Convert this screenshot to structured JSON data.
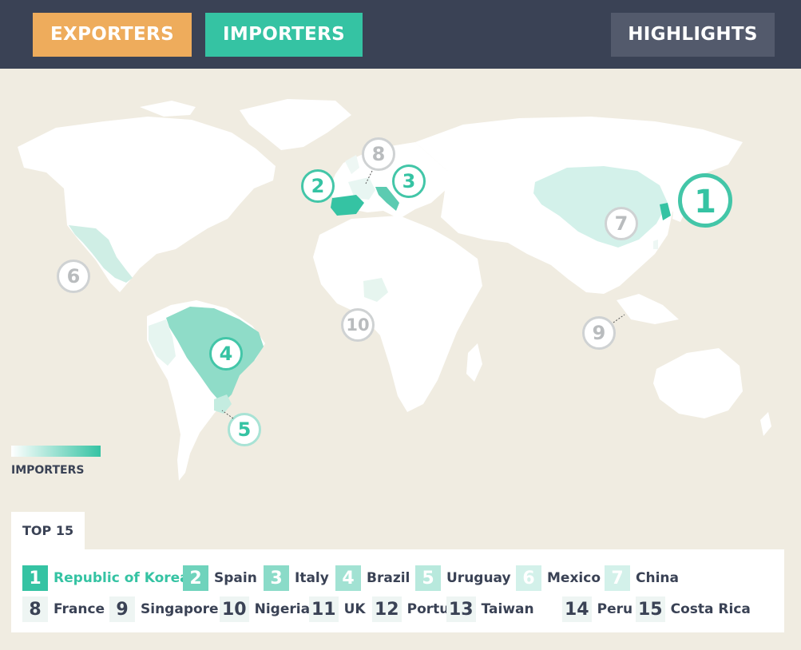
{
  "nav": {
    "tabs": [
      {
        "label": "EXPORTERS",
        "color": "#eeac5c"
      },
      {
        "label": "IMPORTERS",
        "color": "#35c3a3",
        "active": true
      },
      {
        "label": "HIGHLIGHTS",
        "color": "#535a6c"
      }
    ]
  },
  "map": {
    "background": "#f0ece1",
    "land_color": "#ffffff",
    "markers": [
      {
        "label": "1",
        "country": "Republic of Korea"
      },
      {
        "label": "2",
        "country": "Spain"
      },
      {
        "label": "3",
        "country": "Italy"
      },
      {
        "label": "4",
        "country": "Brazil"
      },
      {
        "label": "5",
        "country": "Uruguay"
      },
      {
        "label": "6",
        "country": "Mexico"
      },
      {
        "label": "7",
        "country": "China"
      },
      {
        "label": "8",
        "country": "France"
      },
      {
        "label": "9",
        "country": "Singapore"
      },
      {
        "label": "10",
        "country": "Nigeria"
      }
    ],
    "legend": {
      "label": "IMPORTERS",
      "from_color": "#ffffff",
      "to_color": "#35c3a3"
    }
  },
  "top15": {
    "title": "TOP 15",
    "items": [
      {
        "rank": "1",
        "name": "Republic of Korea",
        "bg": "#35c3a3",
        "fg": "#ffffff",
        "name_color": "#35c3a3"
      },
      {
        "rank": "2",
        "name": "Spain",
        "bg": "#6fd3bc",
        "fg": "#ffffff"
      },
      {
        "rank": "3",
        "name": "Italy",
        "bg": "#8adbc8",
        "fg": "#ffffff"
      },
      {
        "rank": "4",
        "name": "Brazil",
        "bg": "#a2e2d3",
        "fg": "#ffffff"
      },
      {
        "rank": "5",
        "name": "Uruguay",
        "bg": "#b8e9dd",
        "fg": "#ffffff"
      },
      {
        "rank": "6",
        "name": "Mexico",
        "bg": "#d3f1ea",
        "fg": "#ffffff"
      },
      {
        "rank": "7",
        "name": "China",
        "bg": "#d3f1ea",
        "fg": "#ffffff"
      },
      {
        "rank": "8",
        "name": "France",
        "bg": "#eef5f3",
        "fg": "#3a4255"
      },
      {
        "rank": "9",
        "name": "Singapore",
        "bg": "#eef5f3",
        "fg": "#3a4255"
      },
      {
        "rank": "10",
        "name": "Nigeria",
        "bg": "#eef5f3",
        "fg": "#3a4255"
      },
      {
        "rank": "11",
        "name": "UK",
        "bg": "#eef5f3",
        "fg": "#3a4255"
      },
      {
        "rank": "12",
        "name": "Portugal",
        "bg": "#eef5f3",
        "fg": "#3a4255"
      },
      {
        "rank": "13",
        "name": "Taiwan",
        "bg": "#eef5f3",
        "fg": "#3a4255"
      },
      {
        "rank": "14",
        "name": "Peru",
        "bg": "#eef5f3",
        "fg": "#3a4255"
      },
      {
        "rank": "15",
        "name": "Costa Rica",
        "bg": "#eef5f3",
        "fg": "#3a4255"
      }
    ]
  }
}
